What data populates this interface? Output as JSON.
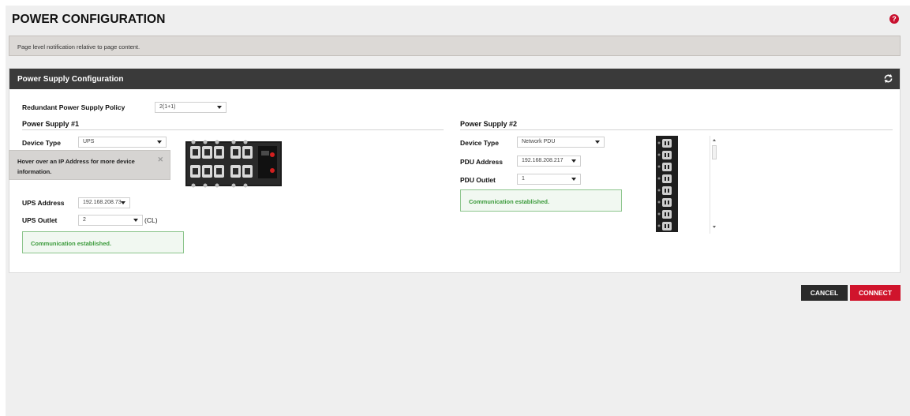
{
  "header": {
    "title": "POWER CONFIGURATION",
    "help_icon": "question-circle-icon"
  },
  "notification": {
    "text": "Page level notification relative to page content."
  },
  "panel": {
    "title": "Power Supply Configuration",
    "refresh_icon": "refresh-icon",
    "policy": {
      "label": "Redundant Power Supply Policy",
      "value": "2(1+1)"
    }
  },
  "ps1": {
    "title": "Power Supply #1",
    "device_type": {
      "label": "Device Type",
      "value": "UPS"
    },
    "tooltip": {
      "text": "Hover over an IP Address for more device information.",
      "close_icon": "close-icon"
    },
    "address": {
      "label": "UPS Address",
      "value": "192.168.208.73"
    },
    "outlet": {
      "label": "UPS Outlet",
      "value": "2",
      "suffix": "(CL)"
    },
    "status": "Communication established.",
    "image": "ups-rear-panel"
  },
  "ps2": {
    "title": "Power Supply #2",
    "device_type": {
      "label": "Device Type",
      "value": "Network PDU"
    },
    "address": {
      "label": "PDU Address",
      "value": "192.168.208.217"
    },
    "outlet": {
      "label": "PDU Outlet",
      "value": "1"
    },
    "status": "Communication established.",
    "image": "pdu-outlet-strip"
  },
  "actions": {
    "cancel": "CANCEL",
    "connect": "CONNECT"
  },
  "colors": {
    "accent": "#d0142c",
    "header_bar": "#3a3a3a",
    "success_text": "#3b9a3b",
    "success_border": "#8cc58c"
  }
}
